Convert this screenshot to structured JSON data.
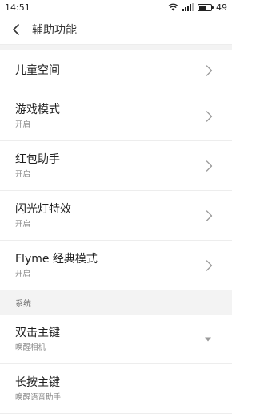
{
  "status_bar": {
    "time": "14:51",
    "battery_level": "49",
    "icons": [
      "wifi-icon",
      "signal-icon",
      "battery-icon"
    ]
  },
  "header": {
    "back_icon": "chevron-left-icon",
    "title": "辅助功能"
  },
  "items": [
    {
      "title": "儿童空间",
      "subtitle": ""
    },
    {
      "title": "游戏模式",
      "subtitle": "开启"
    },
    {
      "title": "红包助手",
      "subtitle": "开启"
    },
    {
      "title": "闪光灯特效",
      "subtitle": "开启"
    },
    {
      "title": "Flyme 经典模式",
      "subtitle": "开启"
    }
  ],
  "section_system": {
    "label": "系统",
    "items": [
      {
        "title": "双击主键",
        "subtitle": "唤醒相机"
      },
      {
        "title": "长按主键",
        "subtitle": "唤醒语音助手"
      }
    ]
  },
  "colors": {
    "divider": "#ededed",
    "section_bg": "#f3f3f3",
    "chevron": "#9a9a9a"
  }
}
